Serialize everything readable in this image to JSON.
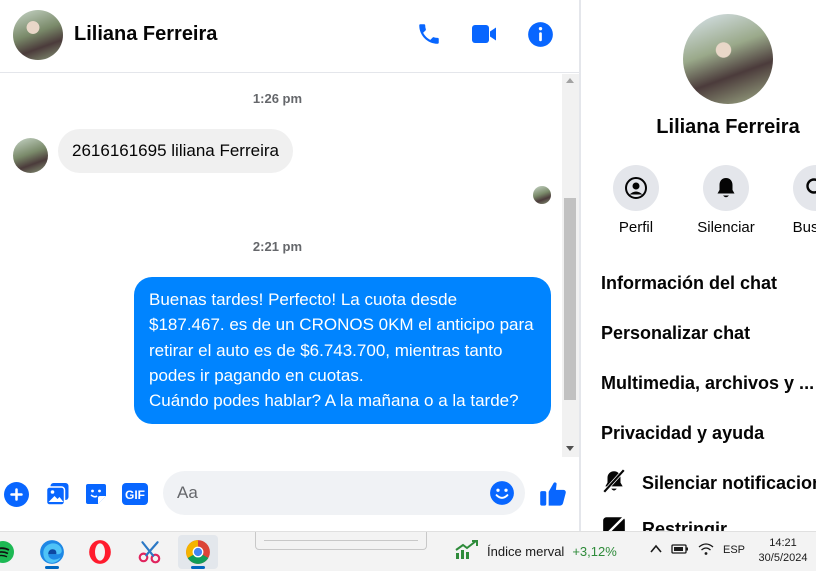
{
  "contact": {
    "name": "Liliana Ferreira"
  },
  "header": {
    "icons": [
      "phone-icon",
      "video-camera-icon",
      "info-icon"
    ]
  },
  "messages": {
    "timestamp_1": "1:26 pm",
    "incoming_text": "2616161695 liliana Ferreira",
    "timestamp_2": "2:21 pm",
    "outgoing_text": "Buenas tardes! Perfecto! La cuota desde $187.467. es de un CRONOS 0KM el anticipo para retirar el auto es de $6.743.700, mientras tanto podes ir pagando en cuotas.\nCuándo podes hablar? A la mañana o a la tarde?"
  },
  "composer": {
    "placeholder": "Aa",
    "gif_label": "GIF"
  },
  "info_panel": {
    "actions": [
      {
        "label": "Perfil",
        "icon": "profile-icon"
      },
      {
        "label": "Silenciar",
        "icon": "bell-icon"
      },
      {
        "label": "Buscar",
        "icon": "search-icon"
      }
    ],
    "menu": {
      "chat_info": "Información del chat",
      "customize": "Personalizar chat",
      "media": "Multimedia, archivos y ...",
      "privacy": "Privacidad y ayuda",
      "mute_notifications": "Silenciar notificaciones",
      "restrict": "Restringir"
    }
  },
  "taskbar": {
    "apps": [
      "spotify-icon",
      "edge-icon",
      "opera-icon",
      "snipping-tool-icon",
      "chrome-icon"
    ],
    "widget_label": "Índice merval",
    "widget_value": "+3,12%",
    "language": "ESP",
    "time": "14:21",
    "date": "30/5/2024"
  },
  "colors": {
    "accent": "#0084ff",
    "icon_blue": "#0866ff",
    "bubble_in": "#f0f0f0",
    "positive": "#2e8b3a"
  }
}
